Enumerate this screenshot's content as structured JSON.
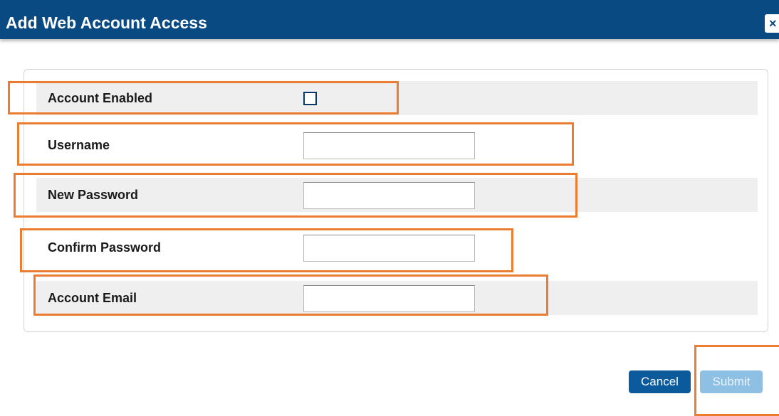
{
  "dialog": {
    "title": "Add Web Account Access",
    "close_label": "×"
  },
  "form": {
    "account_enabled": {
      "label": "Account Enabled",
      "checked": false
    },
    "username": {
      "label": "Username",
      "value": ""
    },
    "new_password": {
      "label": "New Password",
      "value": ""
    },
    "confirm_password": {
      "label": "Confirm Password",
      "value": ""
    },
    "account_email": {
      "label": "Account Email",
      "value": ""
    }
  },
  "buttons": {
    "cancel_label": "Cancel",
    "submit_label": "Submit"
  },
  "colors": {
    "title_bar": "#0a4a83",
    "highlight": "#ec7c30",
    "cancel_button": "#0a5a9c",
    "submit_button_disabled": "#8ec0e4",
    "row_shade": "#efefef"
  }
}
